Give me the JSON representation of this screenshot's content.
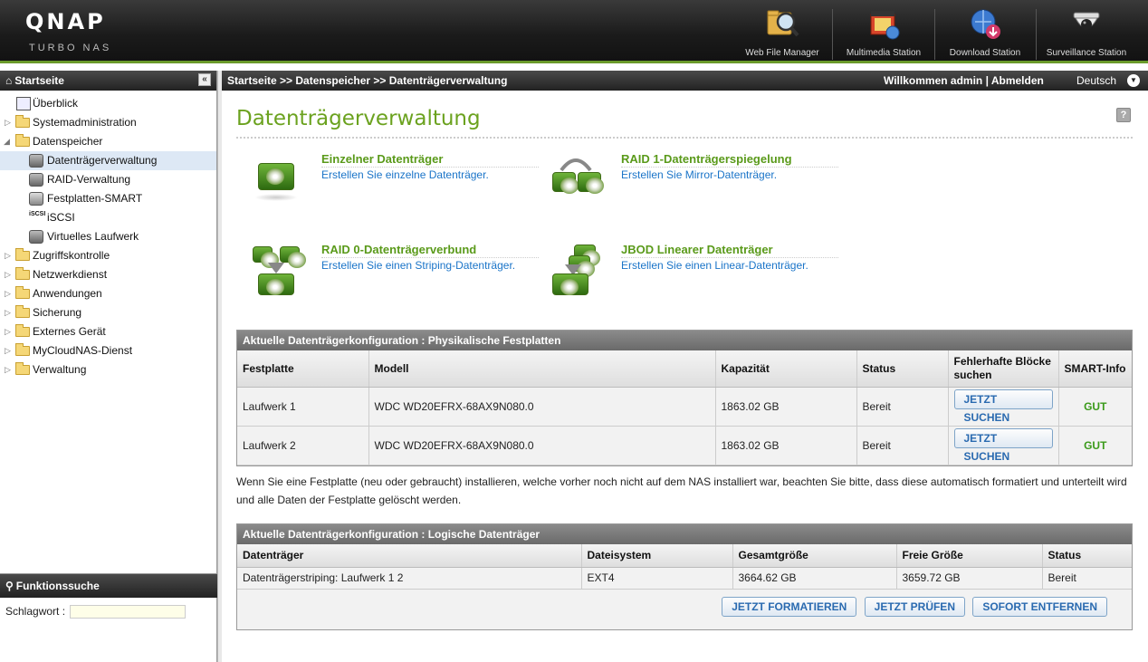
{
  "header": {
    "logo": "QNAP",
    "logo_sub": "Turbo NAS",
    "apps": [
      {
        "label": "Web File Manager",
        "icon": "web-file-manager-icon"
      },
      {
        "label": "Multimedia Station",
        "icon": "multimedia-station-icon"
      },
      {
        "label": "Download Station",
        "icon": "download-station-icon"
      },
      {
        "label": "Surveillance Station",
        "icon": "surveillance-station-icon"
      }
    ]
  },
  "sidebar": {
    "title": "Startseite",
    "items": [
      {
        "label": "Überblick"
      },
      {
        "label": "Systemadministration"
      },
      {
        "label": "Datenspeicher"
      },
      {
        "label": "Datenträgerverwaltung"
      },
      {
        "label": "RAID-Verwaltung"
      },
      {
        "label": "Festplatten-SMART"
      },
      {
        "label": "iSCSI"
      },
      {
        "label": "Virtuelles Laufwerk"
      },
      {
        "label": "Zugriffskontrolle"
      },
      {
        "label": "Netzwerkdienst"
      },
      {
        "label": "Anwendungen"
      },
      {
        "label": "Sicherung"
      },
      {
        "label": "Externes Gerät"
      },
      {
        "label": "MyCloudNAS-Dienst"
      },
      {
        "label": "Verwaltung"
      }
    ],
    "func_title": "Funktionssuche",
    "keyword_label": "Schlagwort :"
  },
  "topbar": {
    "breadcrumb": "Startseite >> Datenspeicher >> Datenträgerverwaltung",
    "welcome": "Willkommen admin | Abmelden",
    "language": "Deutsch"
  },
  "main": {
    "title": "Datenträgerverwaltung",
    "help": "?",
    "options": [
      {
        "title": "Einzelner Datenträger",
        "subtitle": "Erstellen Sie einzelne Datenträger."
      },
      {
        "title": "RAID 1-Datenträgerspiegelung",
        "subtitle": "Erstellen Sie Mirror-Datenträger."
      },
      {
        "title": "RAID 0-Datenträgerverbund",
        "subtitle": "Erstellen Sie einen Striping-Datenträger."
      },
      {
        "title": "JBOD Linearer Datenträger",
        "subtitle": "Erstellen Sie einen Linear-Datenträger."
      }
    ],
    "physical": {
      "heading": "Aktuelle Datenträgerkonfiguration : Physikalische Festplatten",
      "columns": [
        "Festplatte",
        "Modell",
        "Kapazität",
        "Status",
        "Fehlerhafte Blöcke suchen",
        "SMART-Info"
      ],
      "rows": [
        {
          "disk": "Laufwerk 1",
          "model": "WDC WD20EFRX-68AX9N080.0",
          "capacity": "1863.02 GB",
          "status": "Bereit",
          "action": "JETZT SUCHEN",
          "smart": "GUT"
        },
        {
          "disk": "Laufwerk 2",
          "model": "WDC WD20EFRX-68AX9N080.0",
          "capacity": "1863.02 GB",
          "status": "Bereit",
          "action": "JETZT SUCHEN",
          "smart": "GUT"
        }
      ]
    },
    "note": "Wenn Sie eine Festplatte (neu oder gebraucht) installieren, welche vorher noch nicht auf dem NAS installiert war, beachten Sie bitte, dass diese automatisch formatiert und unterteilt wird und alle Daten der Festplatte gelöscht werden.",
    "logical": {
      "heading": "Aktuelle Datenträgerkonfiguration : Logische Datenträger",
      "columns": [
        "Datenträger",
        "Dateisystem",
        "Gesamtgröße",
        "Freie Größe",
        "Status"
      ],
      "rows": [
        {
          "volume": "Datenträgerstriping: Laufwerk 1 2",
          "fs": "EXT4",
          "total": "3664.62 GB",
          "free": "3659.72 GB",
          "status": "Bereit"
        }
      ],
      "buttons": [
        "JETZT FORMATIEREN",
        "JETZT PRÜFEN",
        "SOFORT ENTFERNEN"
      ]
    }
  }
}
